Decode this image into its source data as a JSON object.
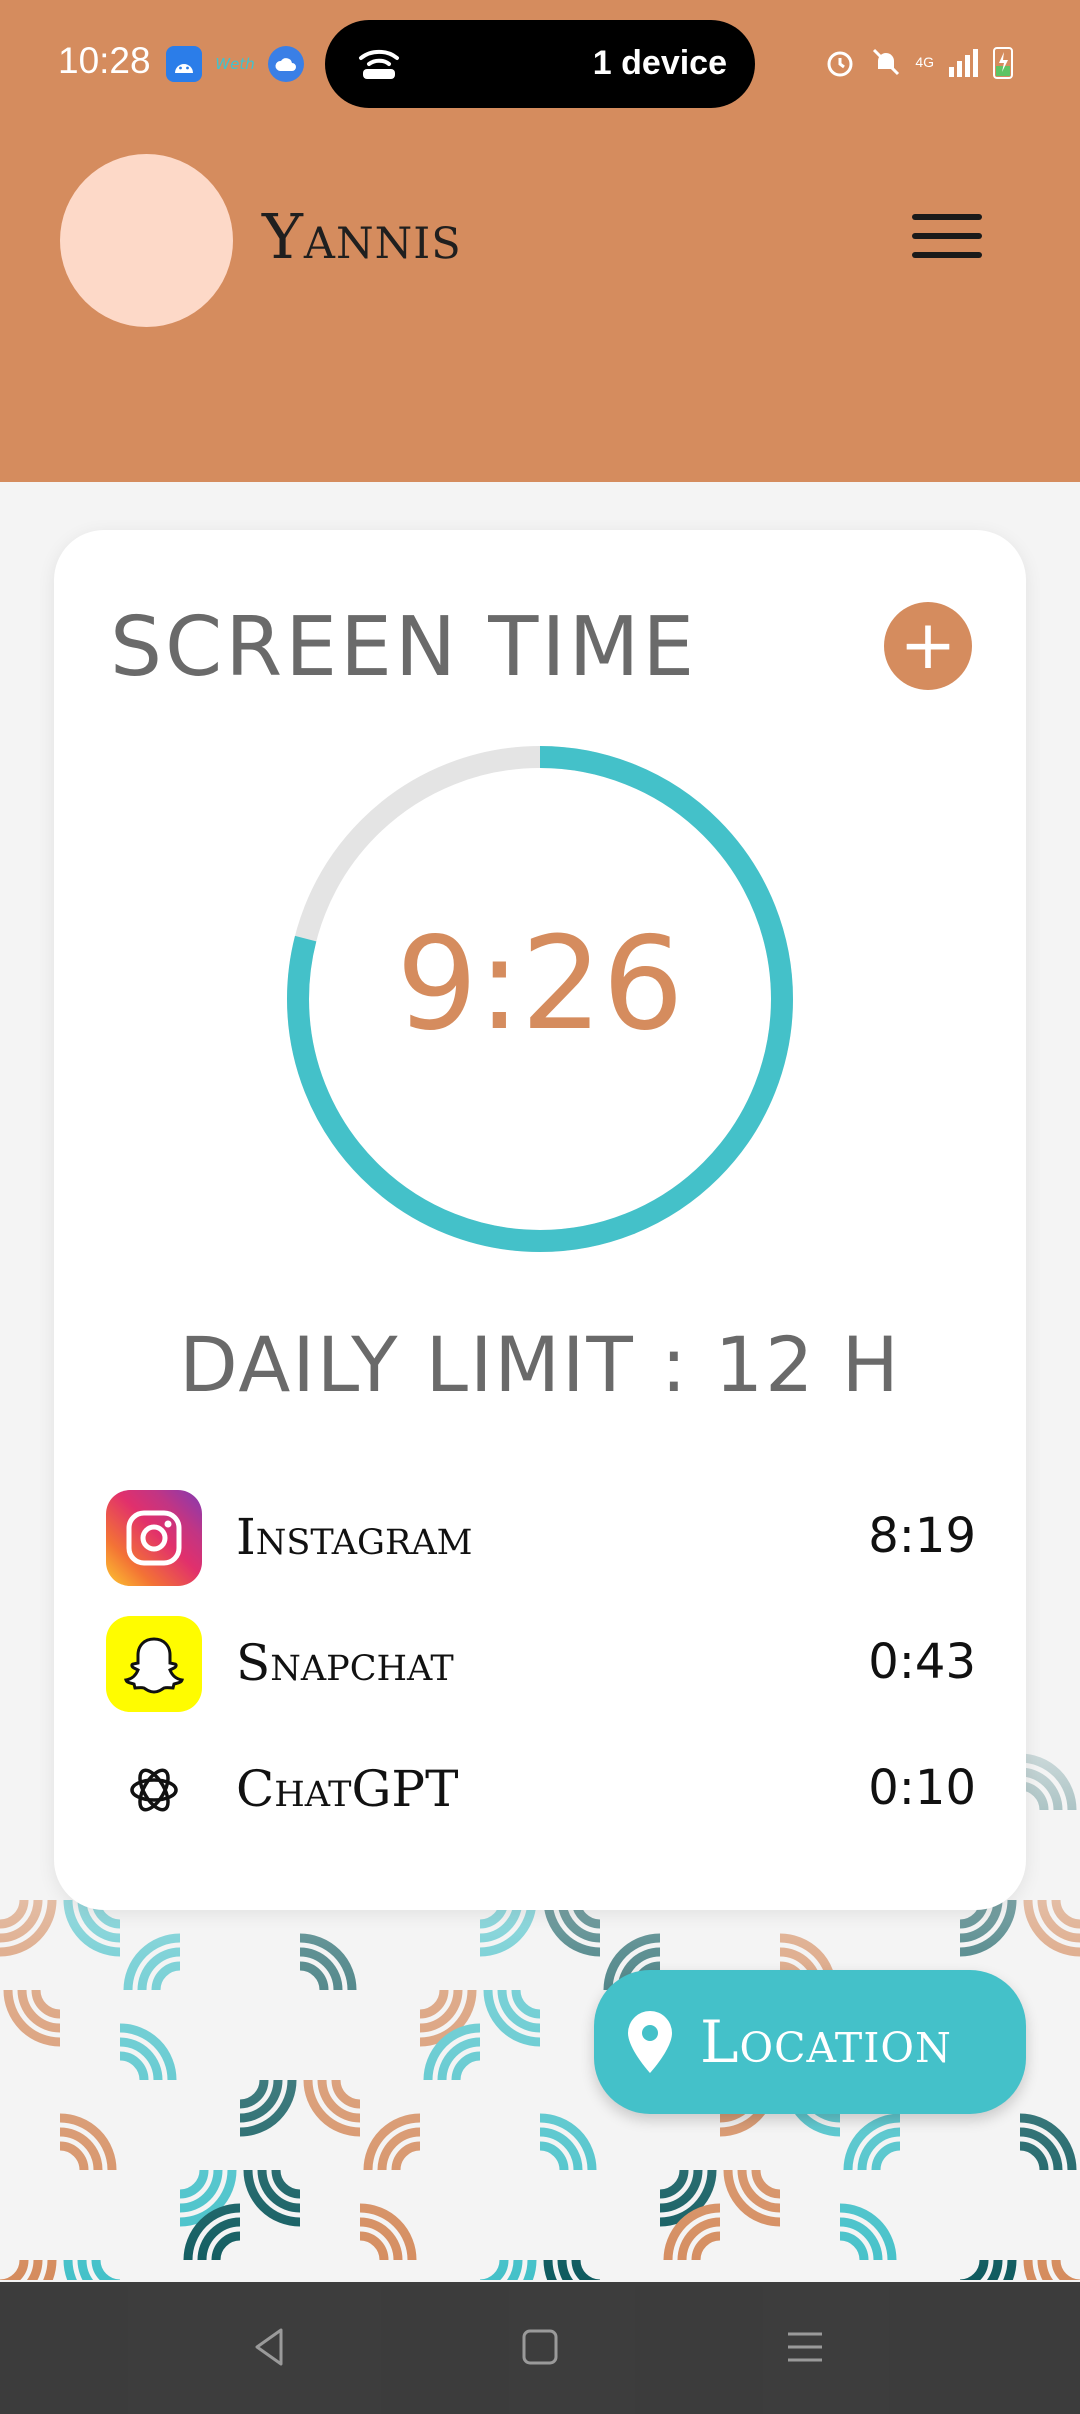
{
  "status_bar": {
    "time": "10:28",
    "island_text": "1 device",
    "weather_label": "Weth",
    "network": "4G"
  },
  "profile": {
    "name": "Yannis"
  },
  "screen_time": {
    "title": "SCREEN TIME",
    "value": "9:26",
    "progress": 0.79,
    "limit_text": "DAILY LIMIT : 12 H"
  },
  "apps": [
    {
      "name": "Instagram",
      "time": "8:19",
      "icon": "instagram-icon"
    },
    {
      "name": "Snapchat",
      "time": "0:43",
      "icon": "snapchat-icon"
    },
    {
      "name": "ChatGPT",
      "time": "0:10",
      "icon": "chatgpt-icon"
    }
  ],
  "location_button": {
    "label": "Location"
  },
  "colors": {
    "primary": "#d58c5e",
    "accent": "#44c1c9",
    "avatar": "#fdd9c8"
  }
}
